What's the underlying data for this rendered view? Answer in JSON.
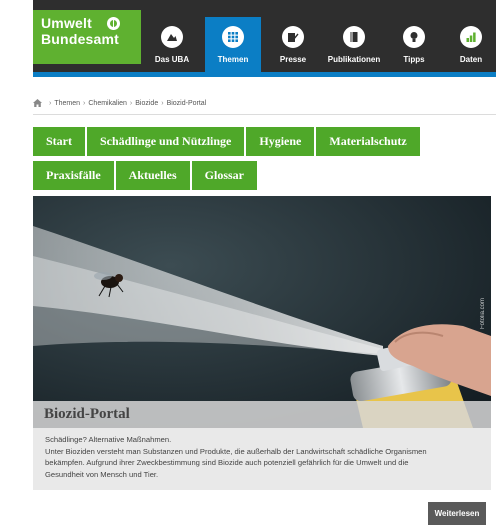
{
  "logo": {
    "line1": "Umwelt",
    "line2": "Bundesamt"
  },
  "nav": [
    {
      "label": "Das UBA",
      "icon": "landscape-icon"
    },
    {
      "label": "Themen",
      "icon": "grid-icon",
      "active": true
    },
    {
      "label": "Presse",
      "icon": "pen-paper-icon"
    },
    {
      "label": "Publikationen",
      "icon": "book-icon"
    },
    {
      "label": "Tipps",
      "icon": "lightbulb-icon"
    },
    {
      "label": "Daten",
      "icon": "bar-chart-icon"
    }
  ],
  "breadcrumb": [
    "Themen",
    "Chemikalien",
    "Biozide",
    "Biozid-Portal"
  ],
  "menu": {
    "row1": [
      "Start",
      "Schädlinge und Nützlinge",
      "Hygiene",
      "Materialschutz"
    ],
    "row2": [
      "Praxisfälle",
      "Aktuelles",
      "Glossar"
    ]
  },
  "hero": {
    "title": "Biozid-Portal",
    "credit": "Fotolia.com"
  },
  "teaser": {
    "headline": "Schädlinge? Alternative Maßnahmen.",
    "line1": "Unter Bioziden versteht man Substanzen und Produkte, die außerhalb der Landwirtschaft schädliche Organismen",
    "line2": "bekämpfen. Aufgrund ihrer Zweckbestimmung sind Biozide auch potenziell gefährlich für die Umwelt und die",
    "line3": "Gesundheit von Mensch und Tier."
  },
  "more_label": "Weiterlesen",
  "colors": {
    "header": "#2e2e2e",
    "brand_green": "#5fb130",
    "menu_green": "#4fa829",
    "active_blue": "#0b7ec5"
  }
}
